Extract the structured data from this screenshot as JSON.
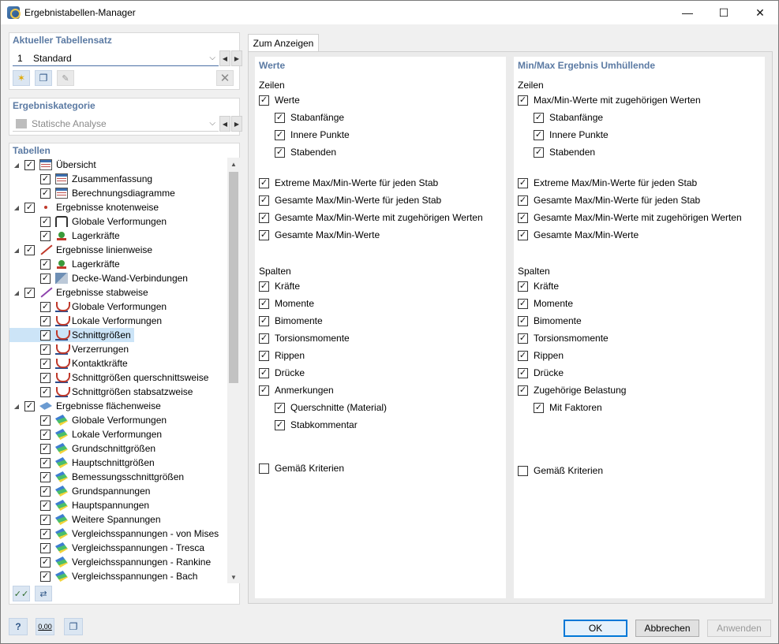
{
  "window": {
    "title": "Ergebnistabellen-Manager",
    "controls": [
      "—",
      "☐",
      "✕"
    ]
  },
  "tableset": {
    "header": "Aktueller Tabellensatz",
    "number": "1",
    "name": "Standard"
  },
  "category": {
    "header": "Ergebniskategorie",
    "value": "Statische Analyse"
  },
  "tables": {
    "header": "Tabellen",
    "items": [
      {
        "label": "Übersicht",
        "level": 0,
        "icon": "table-icon",
        "checked": true
      },
      {
        "label": "Zusammenfassung",
        "level": 1,
        "icon": "table-icon",
        "checked": true
      },
      {
        "label": "Berechnungsdiagramme",
        "level": 1,
        "icon": "table-icon",
        "checked": true
      },
      {
        "label": "Ergebnisse knotenweise",
        "level": 0,
        "icon": "node-icon",
        "checked": true
      },
      {
        "label": "Globale Verformungen",
        "level": 1,
        "icon": "node-deformation-icon",
        "checked": true
      },
      {
        "label": "Lagerkräfte",
        "level": 1,
        "icon": "support-icon",
        "checked": true
      },
      {
        "label": "Ergebnisse linienweise",
        "level": 0,
        "icon": "line-icon",
        "checked": true
      },
      {
        "label": "Lagerkräfte",
        "level": 1,
        "icon": "support-icon",
        "checked": true
      },
      {
        "label": "Decke-Wand-Verbindungen",
        "level": 1,
        "icon": "wall-icon",
        "checked": true
      },
      {
        "label": "Ergebnisse stabweise",
        "level": 0,
        "icon": "member-icon",
        "checked": true
      },
      {
        "label": "Globale Verformungen",
        "level": 1,
        "icon": "member-diagram-icon",
        "checked": true
      },
      {
        "label": "Lokale Verformungen",
        "level": 1,
        "icon": "member-diagram-icon",
        "checked": true
      },
      {
        "label": "Schnittgrößen",
        "level": 1,
        "icon": "member-diagram-icon",
        "checked": true,
        "selected": true
      },
      {
        "label": "Verzerrungen",
        "level": 1,
        "icon": "member-diagram-icon",
        "checked": true
      },
      {
        "label": "Kontaktkräfte",
        "level": 1,
        "icon": "member-diagram-icon",
        "checked": true
      },
      {
        "label": "Schnittgrößen querschnittsweise",
        "level": 1,
        "icon": "member-diagram-icon",
        "checked": true
      },
      {
        "label": "Schnittgrößen stabsatzweise",
        "level": 1,
        "icon": "member-diagram-icon",
        "checked": true
      },
      {
        "label": "Ergebnisse flächenweise",
        "level": 0,
        "icon": "surface-icon",
        "checked": true
      },
      {
        "label": "Globale Verformungen",
        "level": 1,
        "icon": "surface-result-icon",
        "checked": true
      },
      {
        "label": "Lokale Verformungen",
        "level": 1,
        "icon": "surface-result-icon",
        "checked": true
      },
      {
        "label": "Grundschnittgrößen",
        "level": 1,
        "icon": "surface-result-icon",
        "checked": true
      },
      {
        "label": "Hauptschnittgrößen",
        "level": 1,
        "icon": "surface-result-icon",
        "checked": true
      },
      {
        "label": "Bemessungsschnittgrößen",
        "level": 1,
        "icon": "surface-result-icon",
        "checked": true
      },
      {
        "label": "Grundspannungen",
        "level": 1,
        "icon": "surface-result-icon",
        "checked": true
      },
      {
        "label": "Hauptspannungen",
        "level": 1,
        "icon": "surface-result-icon",
        "checked": true
      },
      {
        "label": "Weitere Spannungen",
        "level": 1,
        "icon": "surface-result-icon",
        "checked": true
      },
      {
        "label": "Vergleichsspannungen - von Mises",
        "level": 1,
        "icon": "surface-result-icon",
        "checked": true
      },
      {
        "label": "Vergleichsspannungen - Tresca",
        "level": 1,
        "icon": "surface-result-icon",
        "checked": true
      },
      {
        "label": "Vergleichsspannungen - Rankine",
        "level": 1,
        "icon": "surface-result-icon",
        "checked": true
      },
      {
        "label": "Vergleichsspannungen - Bach",
        "level": 1,
        "icon": "surface-result-icon",
        "checked": true
      }
    ]
  },
  "tab": {
    "label": "Zum Anzeigen"
  },
  "values": {
    "title": "Werte",
    "rows_label": "Zeilen",
    "rows": [
      {
        "label": "Werte",
        "indent": 0,
        "checked": true
      },
      {
        "label": "Stabanfänge",
        "indent": 1,
        "checked": true
      },
      {
        "label": "Innere Punkte",
        "indent": 1,
        "checked": true
      },
      {
        "label": "Stabenden",
        "indent": 1,
        "checked": true
      },
      {
        "label": "Extreme Max/Min-Werte für jeden Stab",
        "indent": 0,
        "checked": true
      },
      {
        "label": "Gesamte Max/Min-Werte für jeden Stab",
        "indent": 0,
        "checked": true
      },
      {
        "label": "Gesamte Max/Min-Werte mit zugehörigen Werten",
        "indent": 0,
        "checked": true
      },
      {
        "label": "Gesamte Max/Min-Werte",
        "indent": 0,
        "checked": true
      }
    ],
    "cols_label": "Spalten",
    "cols": [
      {
        "label": "Kräfte",
        "indent": 0,
        "checked": true
      },
      {
        "label": "Momente",
        "indent": 0,
        "checked": true
      },
      {
        "label": "Bimomente",
        "indent": 0,
        "checked": true
      },
      {
        "label": "Torsionsmomente",
        "indent": 0,
        "checked": true
      },
      {
        "label": "Rippen",
        "indent": 0,
        "checked": true
      },
      {
        "label": "Drücke",
        "indent": 0,
        "checked": true
      },
      {
        "label": "Anmerkungen",
        "indent": 0,
        "checked": true
      },
      {
        "label": "Querschnitte (Material)",
        "indent": 1,
        "checked": true
      },
      {
        "label": "Stabkommentar",
        "indent": 1,
        "checked": true
      }
    ],
    "criteria": {
      "label": "Gemäß Kriterien",
      "checked": false
    }
  },
  "envelope": {
    "title": "Min/Max Ergebnis Umhüllende",
    "rows_label": "Zeilen",
    "rows": [
      {
        "label": "Max/Min-Werte mit zugehörigen Werten",
        "indent": 0,
        "checked": true
      },
      {
        "label": "Stabanfänge",
        "indent": 1,
        "checked": true
      },
      {
        "label": "Innere Punkte",
        "indent": 1,
        "checked": true
      },
      {
        "label": "Stabenden",
        "indent": 1,
        "checked": true
      },
      {
        "label": "Extreme Max/Min-Werte für jeden Stab",
        "indent": 0,
        "checked": true
      },
      {
        "label": "Gesamte Max/Min-Werte für jeden Stab",
        "indent": 0,
        "checked": true
      },
      {
        "label": "Gesamte Max/Min-Werte mit zugehörigen Werten",
        "indent": 0,
        "checked": true
      },
      {
        "label": "Gesamte Max/Min-Werte",
        "indent": 0,
        "checked": true
      }
    ],
    "cols_label": "Spalten",
    "cols": [
      {
        "label": "Kräfte",
        "indent": 0,
        "checked": true
      },
      {
        "label": "Momente",
        "indent": 0,
        "checked": true
      },
      {
        "label": "Bimomente",
        "indent": 0,
        "checked": true
      },
      {
        "label": "Torsionsmomente",
        "indent": 0,
        "checked": true
      },
      {
        "label": "Rippen",
        "indent": 0,
        "checked": true
      },
      {
        "label": "Drücke",
        "indent": 0,
        "checked": true
      },
      {
        "label": "Zugehörige Belastung",
        "indent": 0,
        "checked": true
      },
      {
        "label": "Mit Faktoren",
        "indent": 1,
        "checked": true
      }
    ],
    "criteria": {
      "label": "Gemäß Kriterien",
      "checked": false
    }
  },
  "bottom": {
    "decimals_label": "0,00",
    "ok": "OK",
    "cancel": "Abbrechen",
    "apply": "Anwenden"
  }
}
